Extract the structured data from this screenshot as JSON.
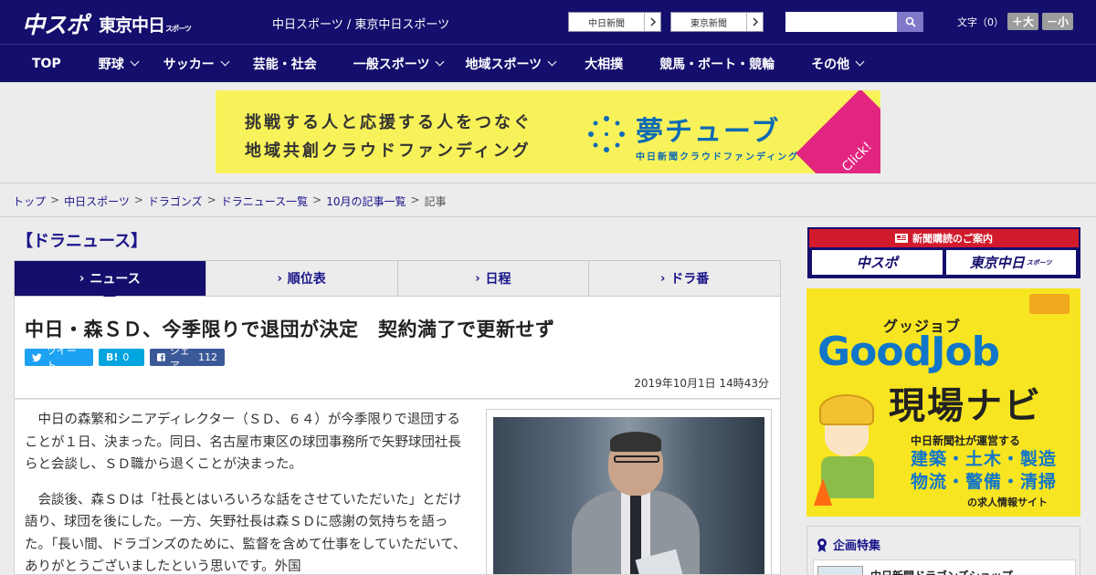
{
  "header": {
    "logo_main": "中スポ",
    "logo_tokyo": "東京中日",
    "logo_tokyo_small": "スポーツ",
    "site_links": "中日スポーツ / 東京中日スポーツ",
    "paper_buttons": [
      "中日新聞",
      "東京新聞"
    ],
    "search_placeholder": "",
    "font_label": "文字（0）",
    "font_bigger": "＋大",
    "font_smaller": "－小"
  },
  "nav": {
    "items": [
      {
        "label": "TOP",
        "has_menu": false
      },
      {
        "label": "野球",
        "has_menu": true
      },
      {
        "label": "サッカー",
        "has_menu": true
      },
      {
        "label": "芸能・社会",
        "has_menu": false
      },
      {
        "label": "一般スポーツ",
        "has_menu": true
      },
      {
        "label": "地域スポーツ",
        "has_menu": true
      },
      {
        "label": "大相撲",
        "has_menu": false
      },
      {
        "label": "競馬・ボート・競輪",
        "has_menu": false
      },
      {
        "label": "その他",
        "has_menu": true
      }
    ]
  },
  "ad": {
    "line1": "挑戦する人と応援する人をつなぐ",
    "line2": "地域共創クラウドファンディング",
    "brand": "夢チューブ",
    "brand_sub": "中日新聞クラウドファンディング",
    "click": "Click!",
    "brand_color": "#0d6ab4",
    "bg_color": "#f8f25a"
  },
  "breadcrumb": {
    "links": [
      "トップ",
      "中日スポーツ",
      "ドラゴンズ",
      "ドラニュース一覧",
      "10月の記事一覧"
    ],
    "current": "記事",
    "separator": ">"
  },
  "section": {
    "title": "【ドラニュース】"
  },
  "tabs": [
    {
      "label": "ニュース",
      "active": true
    },
    {
      "label": "順位表",
      "active": false
    },
    {
      "label": "日程",
      "active": false
    },
    {
      "label": "ドラ番",
      "active": false
    }
  ],
  "article": {
    "headline": "中日・森ＳＤ、今季限りで退団が決定　契約満了で更新せず",
    "share": {
      "tweet_label": "ツイート",
      "hatena_label": "B!",
      "hatena_count": "0",
      "fb_label": "シェア",
      "fb_count": "112"
    },
    "date": "2019年10月1日 14時43分",
    "paragraphs": [
      "中日の森繁和シニアディレクター（ＳＤ、６４）が今季限りで退団することが１日、決まった。同日、名古屋市東区の球団事務所で矢野球団社長らと会談し、ＳＤ職から退くことが決まった。",
      "会談後、森ＳＤは「社長とはいろいろな話をさせていただいた」とだけ語り、球団を後にした。一方、矢野社長は森ＳＤに感謝の気持ちを語った。「長い間、ドラゴンズのために、監督を含めて仕事をしていただいて、ありがとうございましたという思いです。外国"
    ]
  },
  "sidebar": {
    "subscribe_head": "新聞購読のご案内",
    "subscribe_chuspo": "中スポ",
    "subscribe_tokyo": "東京中日",
    "subscribe_tokyo_small": "スポーツ",
    "goodjob": {
      "kana": "グッジョブ",
      "title": "GoodJob",
      "sub": "現場ナビ",
      "line1": "中日新聞社が運営する",
      "line2a": "建築・土木・製造",
      "line2b": "物流・警備・清掃",
      "line3": "の求人情報サイト"
    },
    "feature_title": "企画特集",
    "feature_item": "中日新聞ドラゴンズショップ"
  }
}
